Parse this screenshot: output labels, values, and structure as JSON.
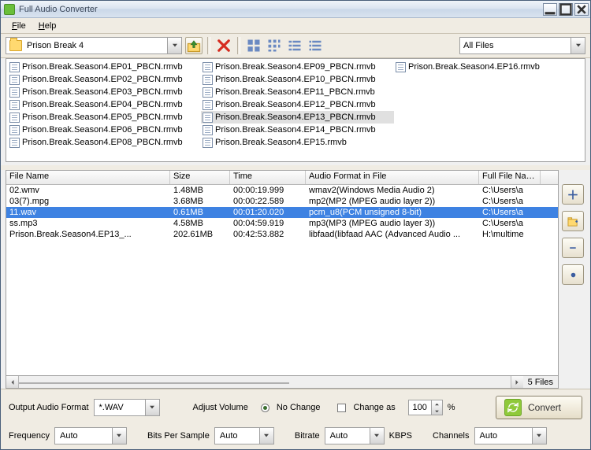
{
  "window": {
    "title": "Full Audio Converter"
  },
  "menu": {
    "file": "File",
    "help": "Help"
  },
  "pathbar": {
    "current_folder": "Prison Break 4",
    "filter": "All Files"
  },
  "browser_files": [
    "Prison.Break.Season4.EP01_PBCN.rmvb",
    "Prison.Break.Season4.EP02_PBCN.rmvb",
    "Prison.Break.Season4.EP03_PBCN.rmvb",
    "Prison.Break.Season4.EP04_PBCN.rmvb",
    "Prison.Break.Season4.EP05_PBCN.rmvb",
    "Prison.Break.Season4.EP06_PBCN.rmvb",
    "Prison.Break.Season4.EP08_PBCN.rmvb",
    "Prison.Break.Season4.EP09_PBCN.rmvb",
    "Prison.Break.Season4.EP10_PBCN.rmvb",
    "Prison.Break.Season4.EP11_PBCN.rmvb",
    "Prison.Break.Season4.EP12_PBCN.rmvb",
    "Prison.Break.Season4.EP13_PBCN.rmvb",
    "Prison.Break.Season4.EP14_PBCN.rmvb",
    "Prison.Break.Season4.EP15.rmvb",
    "Prison.Break.Season4.EP16.rmvb"
  ],
  "browser_selected_index": 11,
  "grid": {
    "headers": {
      "name": "File Name",
      "size": "Size",
      "time": "Time",
      "fmt": "Audio Format in File",
      "path": "Full File Name"
    },
    "rows": [
      {
        "name": "02.wmv",
        "size": "1.48MB",
        "time": "00:00:19.999",
        "fmt": "wmav2(Windows Media Audio 2)",
        "path": "C:\\Users\\a"
      },
      {
        "name": "03(7).mpg",
        "size": "3.68MB",
        "time": "00:00:22.589",
        "fmt": "mp2(MP2 (MPEG audio layer 2))",
        "path": "C:\\Users\\a"
      },
      {
        "name": "11.wav",
        "size": "0.61MB",
        "time": "00:01:20.020",
        "fmt": "pcm_u8(PCM unsigned 8-bit)",
        "path": "C:\\Users\\a"
      },
      {
        "name": "ss.mp3",
        "size": "4.58MB",
        "time": "00:04:59.919",
        "fmt": "mp3(MP3 (MPEG audio layer 3))",
        "path": "C:\\Users\\a"
      },
      {
        "name": "Prison.Break.Season4.EP13_...",
        "size": "202.61MB",
        "time": "00:42:53.882",
        "fmt": "libfaad(libfaad AAC (Advanced Audio ...",
        "path": "H:\\multime"
      }
    ],
    "selected_index": 2,
    "count_label": "5 Files"
  },
  "output": {
    "format_label": "Output Audio Format",
    "format_value": "*.WAV",
    "volume_label": "Adjust Volume",
    "no_change": "No Change",
    "change_as": "Change as",
    "spin_value": "100",
    "percent": "%",
    "convert": "Convert"
  },
  "params": {
    "freq_label": "Frequency",
    "freq_value": "Auto",
    "bits_label": "Bits Per Sample",
    "bits_value": "Auto",
    "bitrate_label": "Bitrate",
    "bitrate_value": "Auto",
    "bitrate_unit": "KBPS",
    "channels_label": "Channels",
    "channels_value": "Auto"
  }
}
